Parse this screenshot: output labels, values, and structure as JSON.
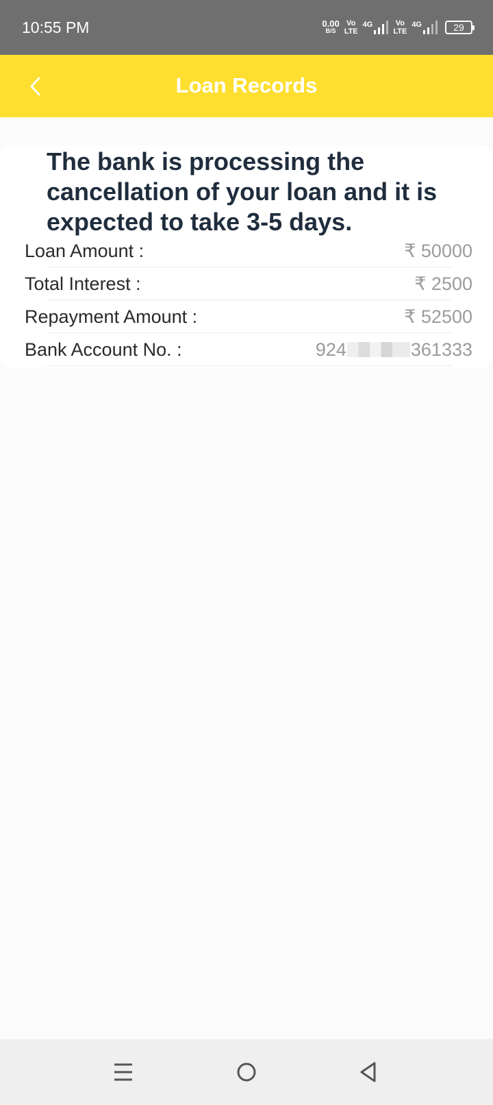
{
  "status_bar": {
    "time": "10:55 PM",
    "net_speed_value": "0.00",
    "net_speed_unit": "B/S",
    "volte_top": "Vo",
    "volte_bottom": "LTE",
    "network_type": "4G",
    "battery_level": "29",
    "icons": [
      "volte-icon",
      "signal-icon",
      "volte-icon",
      "signal-icon",
      "battery-icon"
    ]
  },
  "app_bar": {
    "title": "Loan Records",
    "background_color": "#fedf30",
    "back_icon": "chevron-left-icon"
  },
  "notice": "The bank is processing the cancellation of your loan and it is expected to take 3-5 days.",
  "details": {
    "loan_amount": {
      "label": "Loan Amount :",
      "value": "₹ 50000"
    },
    "total_interest": {
      "label": "Total Interest :",
      "value": "₹ 2500"
    },
    "repayment_amount": {
      "label": "Repayment Amount :",
      "value": "₹ 52500"
    },
    "bank_account": {
      "label": "Bank Account No. :",
      "prefix": "924",
      "suffix": "361333"
    }
  },
  "nav_bar": {
    "icons": [
      "menu-icon",
      "home-icon",
      "back-triangle-icon"
    ]
  }
}
